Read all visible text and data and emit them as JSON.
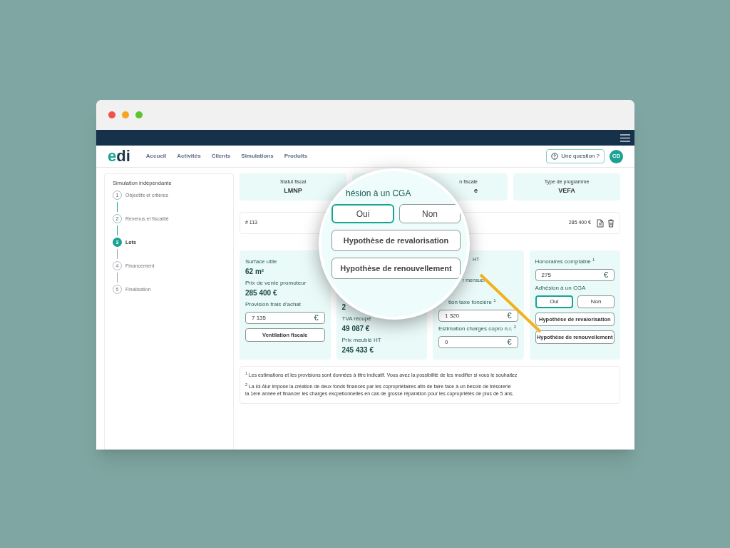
{
  "nav": {
    "logo": "edi",
    "links": [
      "Accueil",
      "Activités",
      "Clients",
      "Simulations",
      "Produits"
    ],
    "help_button": "Une question ?",
    "avatar": "CD"
  },
  "sidebar": {
    "title": "Simulation indépendante",
    "steps": [
      {
        "number": "1",
        "label": "Objectifs et critères",
        "selected": false,
        "completed": true
      },
      {
        "number": "2",
        "label": "Revenus et fiscalité",
        "selected": false,
        "completed": true
      },
      {
        "number": "3",
        "label": "Lots",
        "selected": true,
        "completed": false
      },
      {
        "number": "4",
        "label": "Financement",
        "selected": false,
        "completed": false
      },
      {
        "number": "5",
        "label": "Finalisation",
        "selected": false,
        "completed": false
      }
    ]
  },
  "summary_cards": [
    {
      "kind": "full",
      "label": "Statut fiscal",
      "value": "LMNP"
    },
    {
      "kind": "partial",
      "label": "n fiscale",
      "value": "e"
    },
    {
      "kind": "full",
      "label": "Type de programme",
      "value": "VEFA"
    }
  ],
  "lot": {
    "number": "# 113",
    "price": "285 400 €"
  },
  "cards": [
    {
      "kind": "top",
      "items": [
        {
          "kind": "label",
          "text": "Surface utile"
        },
        {
          "kind": "value",
          "text": "62 m²"
        },
        {
          "kind": "label",
          "text": "Prix de vente promoteur"
        },
        {
          "kind": "value",
          "text": "285 400 €"
        },
        {
          "kind": "label",
          "text": "Provision frais d'achat"
        },
        {
          "kind": "field",
          "value": "7 135",
          "unit": "€"
        },
        {
          "kind": "button",
          "text": "Ventilation fiscale"
        }
      ]
    },
    {
      "kind": "bottom",
      "items": [
        {
          "kind": "value",
          "text": "2"
        },
        {
          "kind": "label",
          "text": "TVA récupé"
        },
        {
          "kind": "value",
          "text": "49 087 €"
        },
        {
          "kind": "label",
          "text": "Prix meublé HT"
        },
        {
          "kind": "value",
          "text": "245 433 €"
        }
      ]
    },
    {
      "kind": "top",
      "items": [
        {
          "kind": "tail",
          "text": "HT"
        },
        {
          "kind": "gap"
        },
        {
          "kind": "tail",
          "text": "r mensuel"
        },
        {
          "kind": "gap"
        },
        {
          "kind": "cut",
          "text": "tion taxe foncière $^{1}$"
        },
        {
          "kind": "field",
          "value": "1 320",
          "unit": "€"
        },
        {
          "kind": "label",
          "text": "Estimation charges copro n.r. $^{2}$"
        },
        {
          "kind": "field",
          "value": "0",
          "unit": "€"
        }
      ]
    },
    {
      "kind": "top",
      "items": [
        {
          "kind": "label",
          "text": "Honoraires comptable $^{1}$"
        },
        {
          "kind": "field",
          "value": "275",
          "unit": "€"
        },
        {
          "kind": "label",
          "text": "Adhésion à un CGA"
        },
        {
          "kind": "toggle",
          "options": [
            {
              "label": "Oui",
              "selected": true
            },
            {
              "label": "Non",
              "selected": false
            }
          ]
        },
        {
          "kind": "button",
          "text": "Hypothèse de revalorisation"
        },
        {
          "kind": "button",
          "text": "Hypothèse de renouvellement"
        }
      ]
    }
  ],
  "footnotes": [
    "$^{1}$ Les estimations et les provisions sont données à titre indicatif. Vous avez la possibilité de les modifier si vous le souhaitez",
    "$^{2}$ La loi Alur impose la création de deux fonds financés par les copropriétaires afin de faire face à un besoin de trésorerie\nla 1ère année et financer les charges excpetionnelles en cas de grosse réparation pour les copropriétés de plus de 5 ans."
  ],
  "magnifier": {
    "label": "hésion à un CGA",
    "options": [
      {
        "label": "Oui",
        "selected": true
      },
      {
        "label": "Non",
        "selected": false
      }
    ],
    "buttons": [
      "Hypothèse de revalorisation",
      "Hypothèse de renouvellement"
    ]
  }
}
